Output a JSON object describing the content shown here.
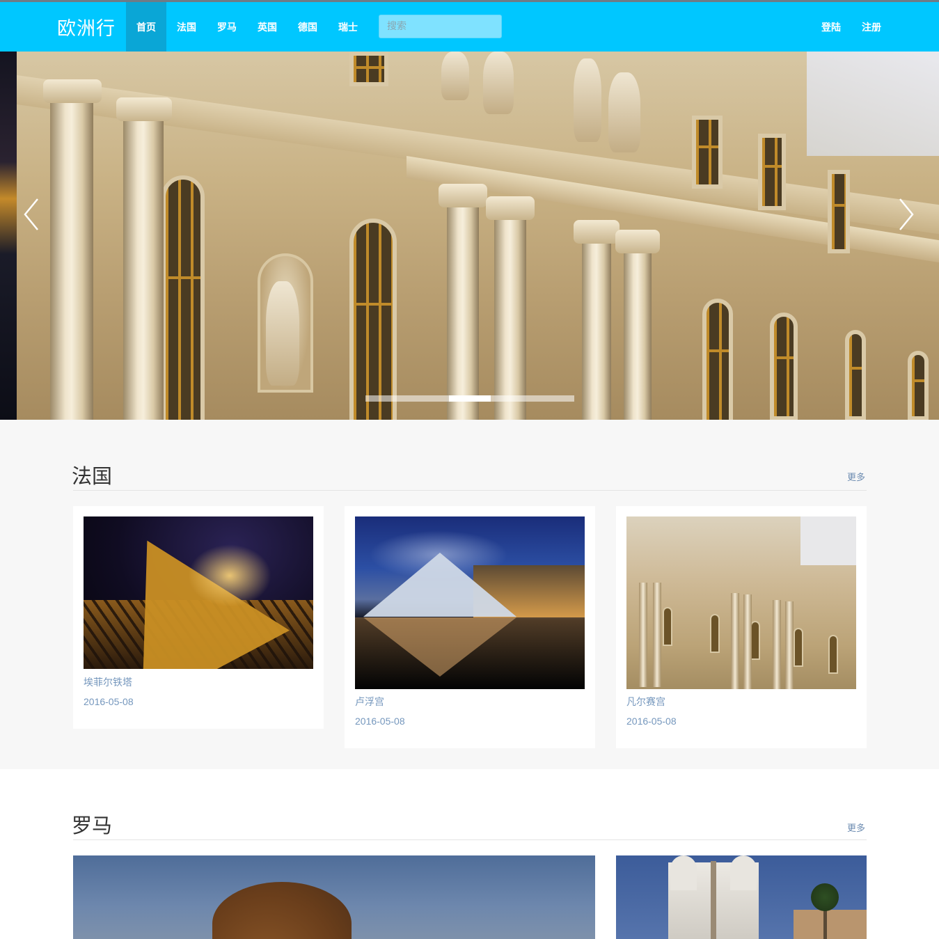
{
  "brand": "欧洲行",
  "nav": {
    "items": [
      {
        "label": "首页",
        "active": true
      },
      {
        "label": "法国",
        "active": false
      },
      {
        "label": "罗马",
        "active": false
      },
      {
        "label": "英国",
        "active": false
      },
      {
        "label": "德国",
        "active": false
      },
      {
        "label": "瑞士",
        "active": false
      }
    ],
    "search_placeholder": "搜索",
    "login": "登陆",
    "register": "注册"
  },
  "carousel": {
    "slide_count": 5,
    "active_index": 2
  },
  "sections": [
    {
      "title": "法国",
      "more": "更多",
      "cards": [
        {
          "title": "埃菲尔铁塔",
          "date": "2016-05-08",
          "image": "eiffel-tower-night"
        },
        {
          "title": "卢浮宫",
          "date": "2016-05-08",
          "image": "louvre-pyramid-night"
        },
        {
          "title": "凡尔赛宫",
          "date": "2016-05-08",
          "image": "versailles-palace"
        }
      ]
    },
    {
      "title": "罗马",
      "more": "更多",
      "cards": [
        {
          "image": "colosseum-dusk"
        },
        {
          "image": "trinita-dei-monti"
        }
      ]
    }
  ],
  "colors": {
    "navbar": "#00c7ff",
    "nav_active": "#0aa6d6",
    "link": "#7597bd",
    "section_bg": "#f7f7f7"
  }
}
